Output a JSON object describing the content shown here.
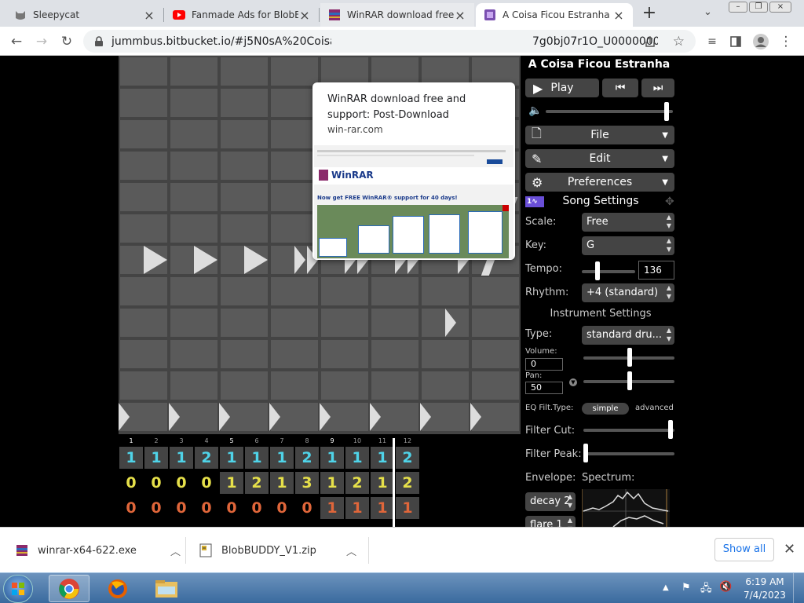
{
  "tabs": [
    {
      "label": "Sleepycat",
      "icon": "cat-icon"
    },
    {
      "label": "Fanmade Ads for BlobBUDDY",
      "icon": "youtube-icon"
    },
    {
      "label": "WinRAR download free and support",
      "icon": "winrar-icon"
    },
    {
      "label": "A Coisa Ficou Estranha - UltraBox",
      "icon": "ultrabox-icon"
    }
  ],
  "new_tab_label": "+",
  "address": "jummbus.bitbucket.io/#j5N0sA%20Coisa%20Ficou%20Estranha...7g0bj07r1O_U0000000...",
  "address_prefix": "jummbus.bitbucket.io/#j5N0sA%20Coisa%",
  "address_suffix": "7g0bj07r1O_U0000000...",
  "popup": {
    "title": "WinRAR download free and support: Post-Download",
    "url": "win-rar.com",
    "thumb_headline": "Now get FREE WinRAR® support for 40 days!",
    "thumb_brand": "WinRAR"
  },
  "song": {
    "title": "A Coisa Ficou Estranha",
    "play_label": "Play",
    "volume_level": 0.97,
    "menus": {
      "file": "File",
      "edit": "Edit",
      "preferences": "Preferences"
    },
    "song_settings_label": "Song Settings",
    "scale_label": "Scale:",
    "scale_value": "Free",
    "key_label": "Key:",
    "key_value": "G",
    "tempo_label": "Tempo:",
    "tempo_value": "136",
    "tempo_level": 0.27,
    "rhythm_label": "Rhythm:",
    "rhythm_value": "+4 (standard)",
    "instrument_settings_label": "Instrument Settings",
    "type_label": "Type:",
    "type_value": "standard dru...",
    "volume_label": "Volume:",
    "volume_value": "0",
    "pan_label": "Pan:",
    "pan_value": "50",
    "eq_label": "EQ Filt.Type:",
    "eq_simple": "simple",
    "eq_advanced": "advanced",
    "filter_cut_label": "Filter Cut:",
    "filter_cut_level": 0.98,
    "filter_peak_label": "Filter Peak:",
    "filter_peak_level": 0.0,
    "envelope_label": "Envelope:",
    "spectrum_label": "Spectrum:",
    "envelope_1": "decay 2",
    "envelope_2": "flare 1"
  },
  "bar_numbers": [
    "1",
    "2",
    "3",
    "4",
    "5",
    "6",
    "7",
    "8",
    "9",
    "10",
    "11",
    "12"
  ],
  "tracks": [
    {
      "color": "#4fd3e8",
      "values": [
        "1",
        "1",
        "1",
        "2",
        "1",
        "1",
        "1",
        "2",
        "1",
        "1",
        "1",
        "2"
      ]
    },
    {
      "color": "#e6e04a",
      "values": [
        "0",
        "0",
        "0",
        "0",
        "1",
        "2",
        "1",
        "3",
        "1",
        "2",
        "1",
        "2"
      ]
    },
    {
      "color": "#e0663a",
      "values": [
        "0",
        "0",
        "0",
        "0",
        "0",
        "0",
        "0",
        "0",
        "1",
        "1",
        "1",
        "1"
      ]
    }
  ],
  "downloads": [
    {
      "name": "winrar-x64-622.exe"
    },
    {
      "name": "BlobBUDDY_V1.zip"
    }
  ],
  "show_all": "Show all",
  "clock": {
    "time": "6:19 AM",
    "date": "7/4/2023"
  }
}
